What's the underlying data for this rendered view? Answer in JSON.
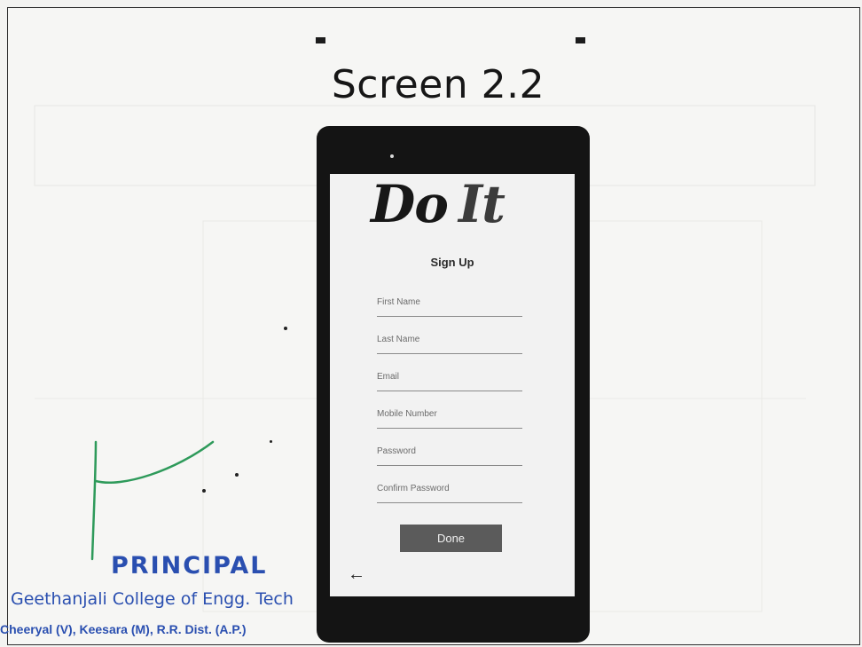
{
  "slide": {
    "title": "Screen 2.2"
  },
  "app": {
    "logo": {
      "part1": "Do",
      "part2": "It"
    },
    "screen_title": "Sign Up",
    "fields": [
      {
        "label": "First Name"
      },
      {
        "label": "Last Name"
      },
      {
        "label": "Email"
      },
      {
        "label": "Mobile Number"
      },
      {
        "label": "Password"
      },
      {
        "label": "Confirm Password"
      }
    ],
    "done_label": "Done",
    "back_icon": "back-arrow-icon"
  },
  "stamp": {
    "title": "PRINCIPAL",
    "college": "Geethanjali College of Engg. Tech",
    "address": "Cheeryal (V), Keesara (M), R.R. Dist. (A.P.)"
  },
  "colors": {
    "stamp_ink": "#2a4fb0",
    "signature_ink": "#2e9a5a",
    "phone_body": "#141414",
    "button": "#5b5b5b"
  }
}
